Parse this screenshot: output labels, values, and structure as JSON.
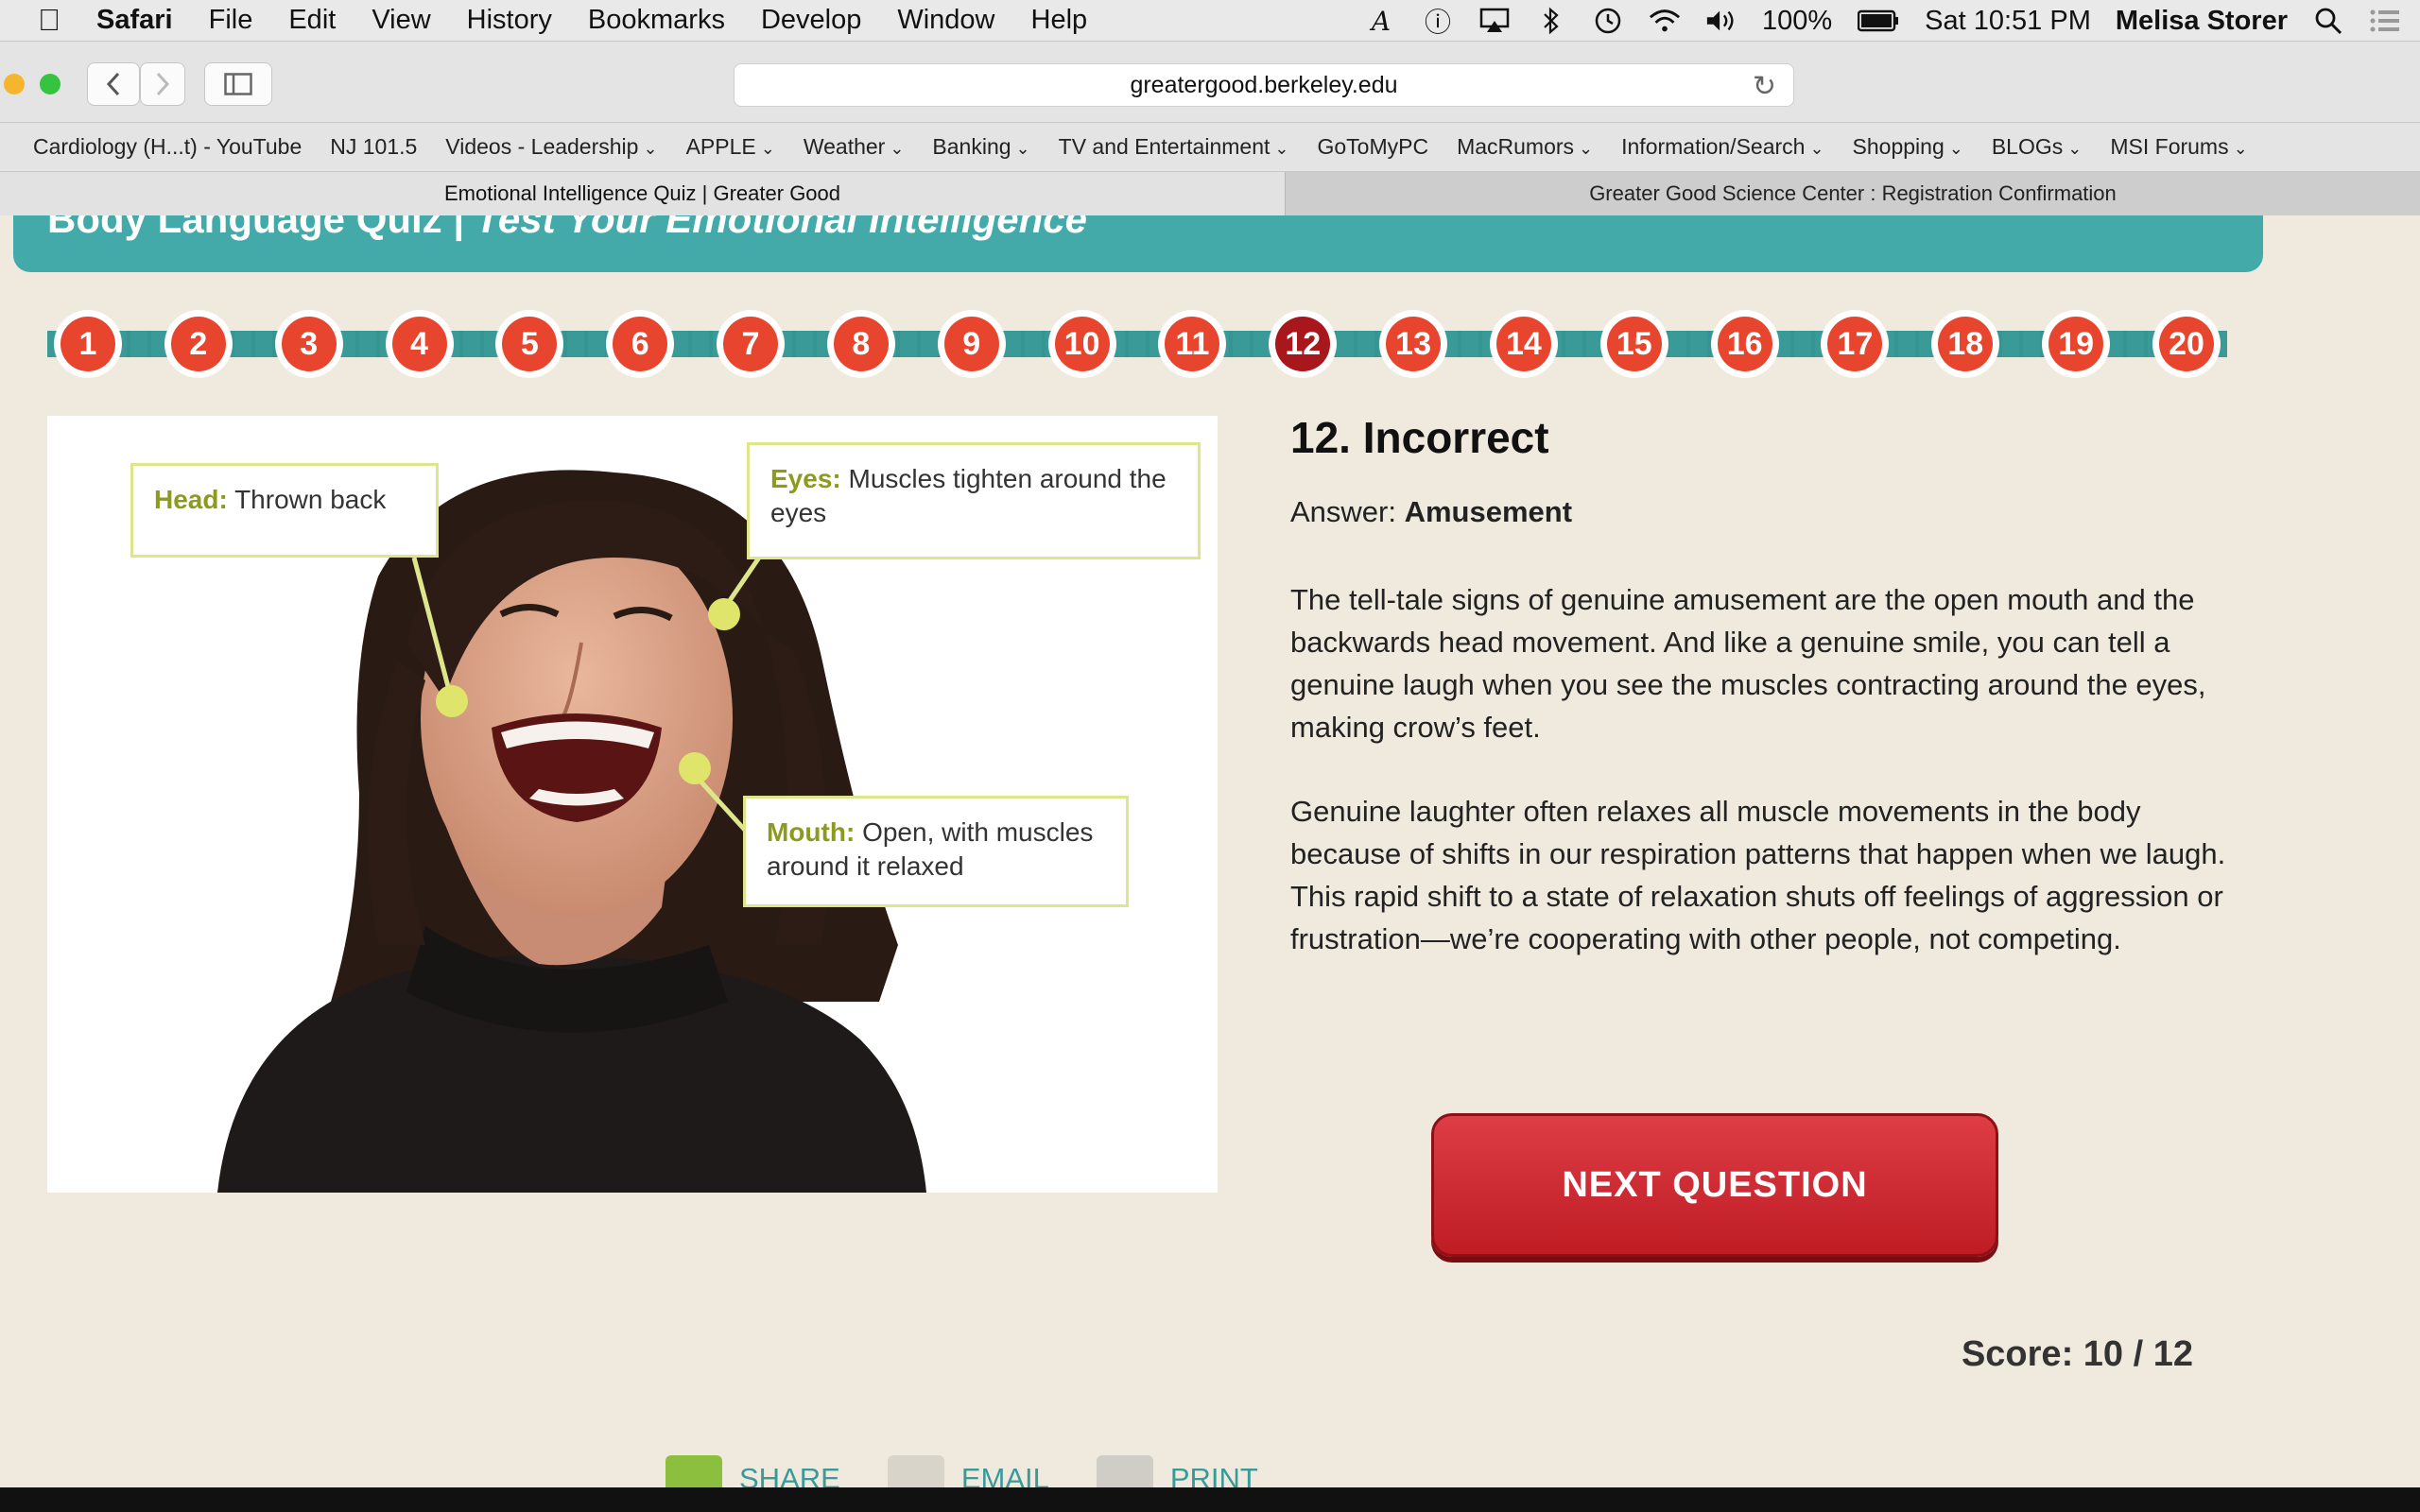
{
  "menubar": {
    "app": "Safari",
    "items": [
      "File",
      "Edit",
      "View",
      "History",
      "Bookmarks",
      "Develop",
      "Window",
      "Help"
    ],
    "battery": "100%",
    "clock": "Sat 10:51 PM",
    "user": "Melisa Storer"
  },
  "browser": {
    "url": "greatergood.berkeley.edu",
    "bookmarks": [
      {
        "label": "Cardiology (H...t) - YouTube",
        "dropdown": false
      },
      {
        "label": "NJ 101.5",
        "dropdown": false
      },
      {
        "label": "Videos - Leadership",
        "dropdown": true
      },
      {
        "label": " APPLE",
        "dropdown": true
      },
      {
        "label": "Weather",
        "dropdown": true
      },
      {
        "label": "Banking",
        "dropdown": true
      },
      {
        "label": "TV and Entertainment",
        "dropdown": true
      },
      {
        "label": "GoToMyPC",
        "dropdown": false
      },
      {
        "label": "MacRumors",
        "dropdown": true
      },
      {
        "label": "Information/Search",
        "dropdown": true
      },
      {
        "label": "Shopping",
        "dropdown": true
      },
      {
        "label": "BLOGs",
        "dropdown": true
      },
      {
        "label": "MSI Forums",
        "dropdown": true
      }
    ],
    "tabs": [
      {
        "label": "Emotional Intelligence Quiz | Greater Good",
        "active": true
      },
      {
        "label": "Greater Good Science Center : Registration Confirmation",
        "active": false
      }
    ]
  },
  "page": {
    "header_title": "Body Language Quiz",
    "header_separator": "|",
    "header_subtitle": "Test Your Emotional Intelligence",
    "questions": [
      "1",
      "2",
      "3",
      "4",
      "5",
      "6",
      "7",
      "8",
      "9",
      "10",
      "11",
      "12",
      "13",
      "14",
      "15",
      "16",
      "17",
      "18",
      "19",
      "20"
    ],
    "current_question": 12,
    "image_callouts": {
      "head_label": "Head:",
      "head_text": "Thrown back",
      "eyes_label": "Eyes:",
      "eyes_text": "Muscles tighten around the eyes",
      "mouth_label": "Mouth:",
      "mouth_text": "Open, with muscles around it relaxed"
    },
    "result_title": "12. Incorrect",
    "answer_prefix": "Answer:",
    "answer_value": "Amusement",
    "paragraph_1": "The tell-tale signs of genuine amusement are the open mouth and the backwards head movement. And like a genuine smile, you can tell a genuine laugh when you see the muscles contracting around the eyes, making crow’s feet.",
    "paragraph_2": "Genuine laughter often relaxes all muscle movements in the body because of shifts in our respiration patterns that happen when we laugh. This rapid shift to a state of relaxation shuts off feelings of aggression or frustration—we’re cooperating with other people, not competing.",
    "next_button": "NEXT QUESTION",
    "score_text": "Score: 10 / 12",
    "share_items": [
      "SHARE",
      "EMAIL",
      "PRINT"
    ]
  },
  "colors": {
    "teal": "#44a9a9",
    "bubble": "#e8452e",
    "bubble_current": "#a8171b",
    "button": "#c8202a",
    "callout_accent": "#8c9a1d"
  }
}
